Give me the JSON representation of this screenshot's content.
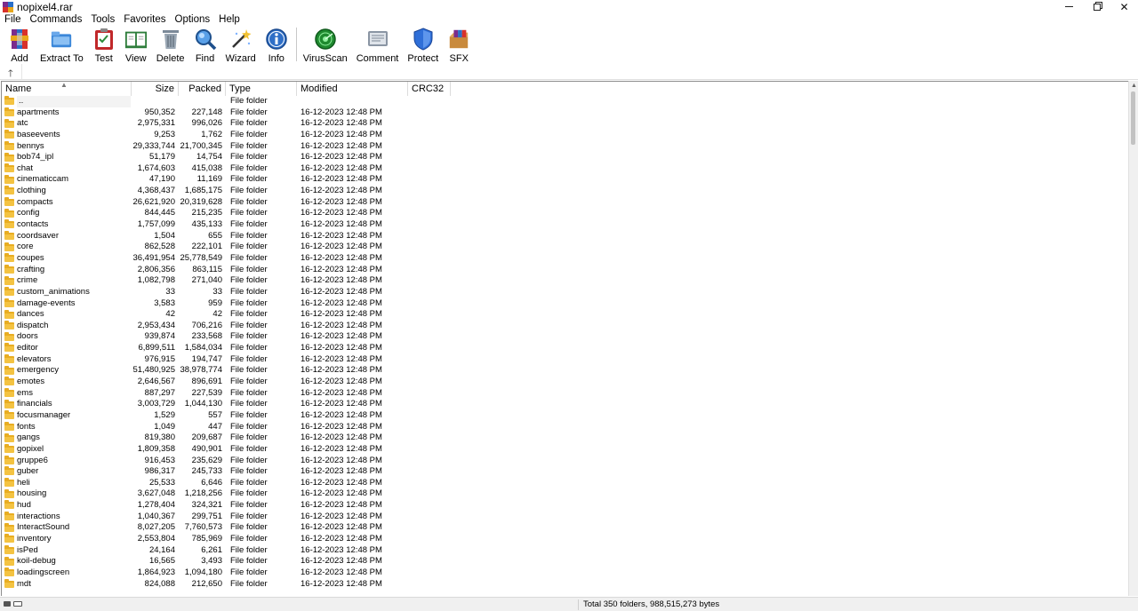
{
  "window": {
    "title": "nopixel4.rar"
  },
  "menu": [
    "File",
    "Commands",
    "Tools",
    "Favorites",
    "Options",
    "Help"
  ],
  "toolbar": [
    {
      "label": "Add",
      "icon": "add-archive-icon"
    },
    {
      "label": "Extract To",
      "icon": "extract-folder-icon"
    },
    {
      "label": "Test",
      "icon": "test-clipboard-icon"
    },
    {
      "label": "View",
      "icon": "view-book-icon"
    },
    {
      "label": "Delete",
      "icon": "trash-icon"
    },
    {
      "label": "Find",
      "icon": "magnifier-icon"
    },
    {
      "label": "Wizard",
      "icon": "wand-icon"
    },
    {
      "label": "Info",
      "icon": "info-icon"
    },
    {
      "label": "VirusScan",
      "icon": "radar-icon"
    },
    {
      "label": "Comment",
      "icon": "comment-icon"
    },
    {
      "label": "Protect",
      "icon": "shield-icon"
    },
    {
      "label": "SFX",
      "icon": "sfx-box-icon"
    }
  ],
  "columns": {
    "name": "Name",
    "size": "Size",
    "packed": "Packed",
    "type": "Type",
    "modified": "Modified",
    "crc": "CRC32"
  },
  "rows": [
    {
      "name": "..",
      "size": "",
      "packed": "",
      "type": "File folder",
      "modified": ""
    },
    {
      "name": "apartments",
      "size": "950,352",
      "packed": "227,148",
      "type": "File folder",
      "modified": "16-12-2023 12:48 PM"
    },
    {
      "name": "atc",
      "size": "2,975,331",
      "packed": "996,026",
      "type": "File folder",
      "modified": "16-12-2023 12:48 PM"
    },
    {
      "name": "baseevents",
      "size": "9,253",
      "packed": "1,762",
      "type": "File folder",
      "modified": "16-12-2023 12:48 PM"
    },
    {
      "name": "bennys",
      "size": "29,333,744",
      "packed": "21,700,345",
      "type": "File folder",
      "modified": "16-12-2023 12:48 PM"
    },
    {
      "name": "bob74_ipl",
      "size": "51,179",
      "packed": "14,754",
      "type": "File folder",
      "modified": "16-12-2023 12:48 PM"
    },
    {
      "name": "chat",
      "size": "1,674,603",
      "packed": "415,038",
      "type": "File folder",
      "modified": "16-12-2023 12:48 PM"
    },
    {
      "name": "cinematiccam",
      "size": "47,190",
      "packed": "11,169",
      "type": "File folder",
      "modified": "16-12-2023 12:48 PM"
    },
    {
      "name": "clothing",
      "size": "4,368,437",
      "packed": "1,685,175",
      "type": "File folder",
      "modified": "16-12-2023 12:48 PM"
    },
    {
      "name": "compacts",
      "size": "26,621,920",
      "packed": "20,319,628",
      "type": "File folder",
      "modified": "16-12-2023 12:48 PM"
    },
    {
      "name": "config",
      "size": "844,445",
      "packed": "215,235",
      "type": "File folder",
      "modified": "16-12-2023 12:48 PM"
    },
    {
      "name": "contacts",
      "size": "1,757,099",
      "packed": "435,133",
      "type": "File folder",
      "modified": "16-12-2023 12:48 PM"
    },
    {
      "name": "coordsaver",
      "size": "1,504",
      "packed": "655",
      "type": "File folder",
      "modified": "16-12-2023 12:48 PM"
    },
    {
      "name": "core",
      "size": "862,528",
      "packed": "222,101",
      "type": "File folder",
      "modified": "16-12-2023 12:48 PM"
    },
    {
      "name": "coupes",
      "size": "36,491,954",
      "packed": "25,778,549",
      "type": "File folder",
      "modified": "16-12-2023 12:48 PM"
    },
    {
      "name": "crafting",
      "size": "2,806,356",
      "packed": "863,115",
      "type": "File folder",
      "modified": "16-12-2023 12:48 PM"
    },
    {
      "name": "crime",
      "size": "1,082,798",
      "packed": "271,040",
      "type": "File folder",
      "modified": "16-12-2023 12:48 PM"
    },
    {
      "name": "custom_animations",
      "size": "33",
      "packed": "33",
      "type": "File folder",
      "modified": "16-12-2023 12:48 PM"
    },
    {
      "name": "damage-events",
      "size": "3,583",
      "packed": "959",
      "type": "File folder",
      "modified": "16-12-2023 12:48 PM"
    },
    {
      "name": "dances",
      "size": "42",
      "packed": "42",
      "type": "File folder",
      "modified": "16-12-2023 12:48 PM"
    },
    {
      "name": "dispatch",
      "size": "2,953,434",
      "packed": "706,216",
      "type": "File folder",
      "modified": "16-12-2023 12:48 PM"
    },
    {
      "name": "doors",
      "size": "939,874",
      "packed": "233,568",
      "type": "File folder",
      "modified": "16-12-2023 12:48 PM"
    },
    {
      "name": "editor",
      "size": "6,899,511",
      "packed": "1,584,034",
      "type": "File folder",
      "modified": "16-12-2023 12:48 PM"
    },
    {
      "name": "elevators",
      "size": "976,915",
      "packed": "194,747",
      "type": "File folder",
      "modified": "16-12-2023 12:48 PM"
    },
    {
      "name": "emergency",
      "size": "51,480,925",
      "packed": "38,978,774",
      "type": "File folder",
      "modified": "16-12-2023 12:48 PM"
    },
    {
      "name": "emotes",
      "size": "2,646,567",
      "packed": "896,691",
      "type": "File folder",
      "modified": "16-12-2023 12:48 PM"
    },
    {
      "name": "ems",
      "size": "887,297",
      "packed": "227,539",
      "type": "File folder",
      "modified": "16-12-2023 12:48 PM"
    },
    {
      "name": "financials",
      "size": "3,003,729",
      "packed": "1,044,130",
      "type": "File folder",
      "modified": "16-12-2023 12:48 PM"
    },
    {
      "name": "focusmanager",
      "size": "1,529",
      "packed": "557",
      "type": "File folder",
      "modified": "16-12-2023 12:48 PM"
    },
    {
      "name": "fonts",
      "size": "1,049",
      "packed": "447",
      "type": "File folder",
      "modified": "16-12-2023 12:48 PM"
    },
    {
      "name": "gangs",
      "size": "819,380",
      "packed": "209,687",
      "type": "File folder",
      "modified": "16-12-2023 12:48 PM"
    },
    {
      "name": "gopixel",
      "size": "1,809,358",
      "packed": "490,901",
      "type": "File folder",
      "modified": "16-12-2023 12:48 PM"
    },
    {
      "name": "gruppe6",
      "size": "916,453",
      "packed": "235,629",
      "type": "File folder",
      "modified": "16-12-2023 12:48 PM"
    },
    {
      "name": "guber",
      "size": "986,317",
      "packed": "245,733",
      "type": "File folder",
      "modified": "16-12-2023 12:48 PM"
    },
    {
      "name": "heli",
      "size": "25,533",
      "packed": "6,646",
      "type": "File folder",
      "modified": "16-12-2023 12:48 PM"
    },
    {
      "name": "housing",
      "size": "3,627,048",
      "packed": "1,218,256",
      "type": "File folder",
      "modified": "16-12-2023 12:48 PM"
    },
    {
      "name": "hud",
      "size": "1,278,404",
      "packed": "324,321",
      "type": "File folder",
      "modified": "16-12-2023 12:48 PM"
    },
    {
      "name": "interactions",
      "size": "1,040,367",
      "packed": "299,751",
      "type": "File folder",
      "modified": "16-12-2023 12:48 PM"
    },
    {
      "name": "InteractSound",
      "size": "8,027,205",
      "packed": "7,760,573",
      "type": "File folder",
      "modified": "16-12-2023 12:48 PM"
    },
    {
      "name": "inventory",
      "size": "2,553,804",
      "packed": "785,969",
      "type": "File folder",
      "modified": "16-12-2023 12:48 PM"
    },
    {
      "name": "isPed",
      "size": "24,164",
      "packed": "6,261",
      "type": "File folder",
      "modified": "16-12-2023 12:48 PM"
    },
    {
      "name": "koil-debug",
      "size": "16,565",
      "packed": "3,493",
      "type": "File folder",
      "modified": "16-12-2023 12:48 PM"
    },
    {
      "name": "loadingscreen",
      "size": "1,864,923",
      "packed": "1,094,180",
      "type": "File folder",
      "modified": "16-12-2023 12:48 PM"
    },
    {
      "name": "mdt",
      "size": "824,088",
      "packed": "212,650",
      "type": "File folder",
      "modified": "16-12-2023 12:48 PM"
    }
  ],
  "status": {
    "text": "Total 350 folders, 988,515,273 bytes"
  },
  "colors": {
    "folder": "#f4c342",
    "border": "#8c8c8c",
    "statusbar": "#f0f0f0"
  }
}
